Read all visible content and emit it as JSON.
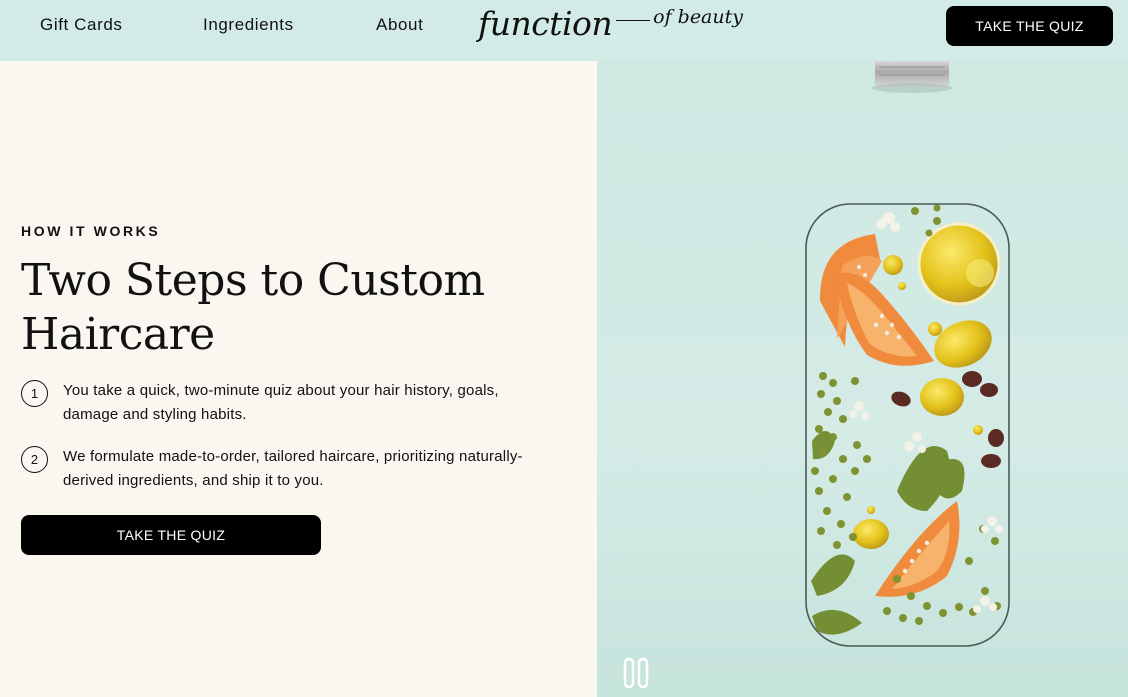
{
  "nav": {
    "links": [
      "Gift Cards",
      "Ingredients",
      "About"
    ],
    "logo_main": "function",
    "logo_sub": "of beauty",
    "cta_label": "TAKE THE QUIZ"
  },
  "hero": {
    "eyebrow": "HOW IT WORKS",
    "headline": "Two Steps to Custom Haircare",
    "steps": [
      {
        "num": "1",
        "text": "You take a quick, two-minute quiz about your hair history, goals, damage and styling habits."
      },
      {
        "num": "2",
        "text": "We formulate made-to-order, tailored haircare, prioritizing naturally-derived ingredients, and ship it to you."
      }
    ],
    "cta_label": "TAKE THE QUIZ"
  },
  "media": {
    "control_icon": "pause-icon",
    "colors": {
      "background": "#d3ebe6",
      "papaya": "#f08a3c",
      "oil": "#e3c21a",
      "herb": "#6f8a2a"
    }
  }
}
